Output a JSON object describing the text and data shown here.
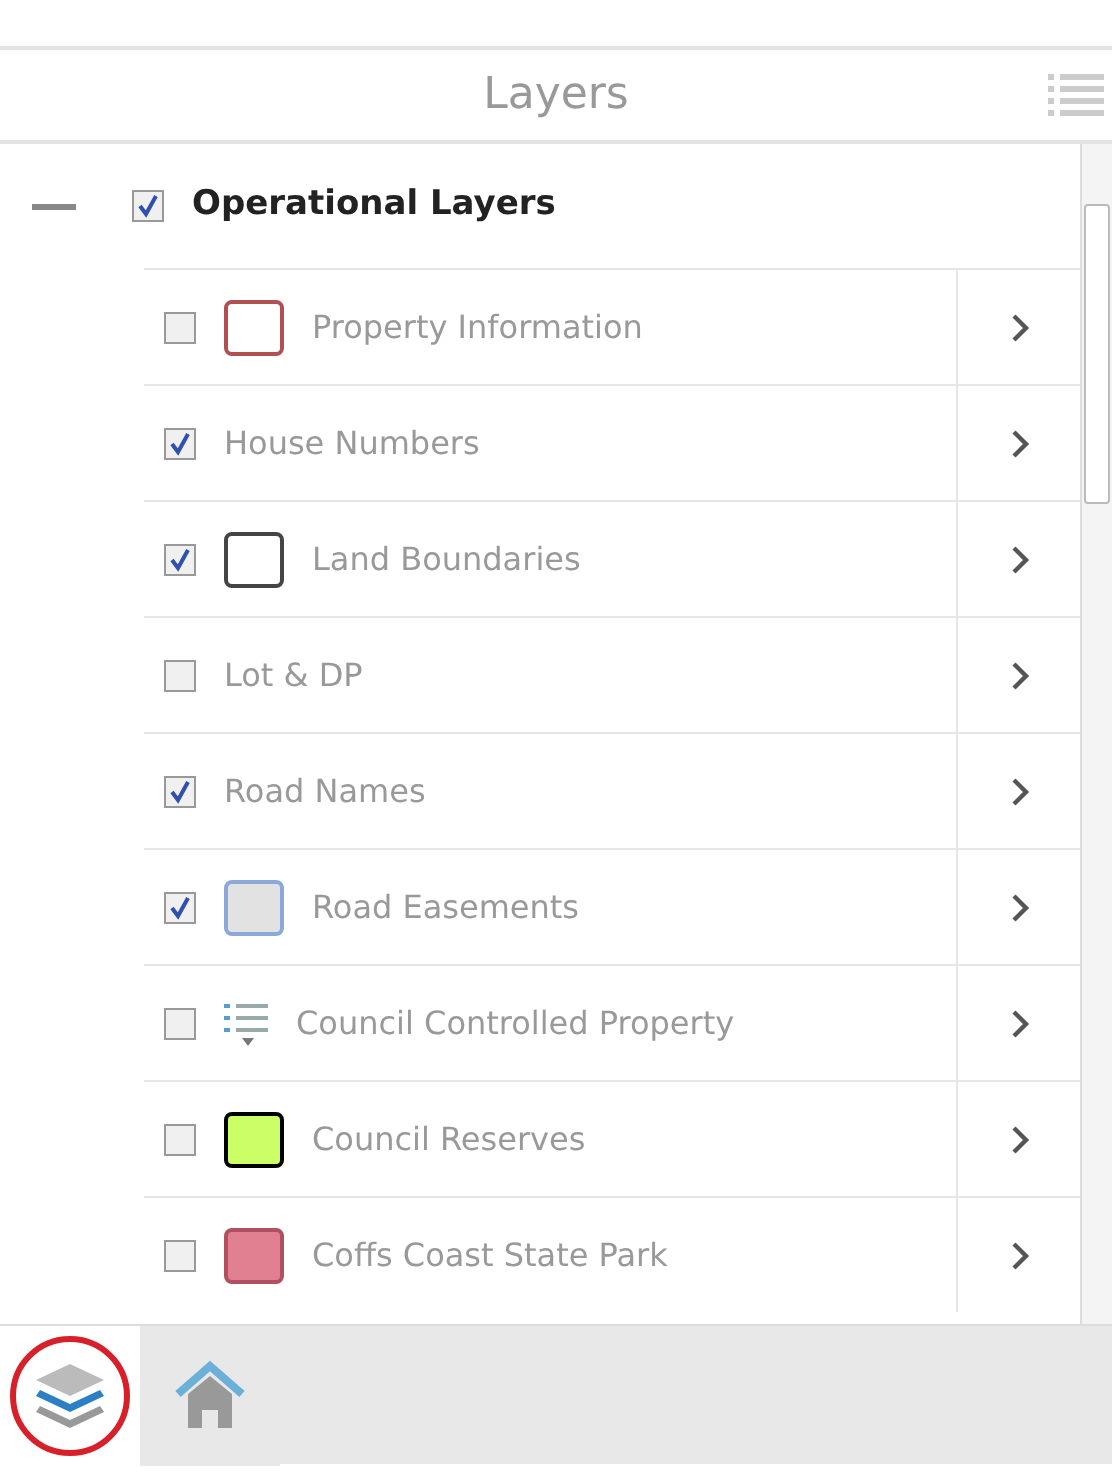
{
  "panel": {
    "title": "Layers"
  },
  "group": {
    "label": "Operational Layers",
    "expanded": true,
    "checked": true
  },
  "layers": [
    {
      "label": "Property Information",
      "checked": false,
      "kind": "swatch",
      "outline": {
        "color": "#b05050"
      },
      "fill": {
        "color": "#ffffff"
      }
    },
    {
      "label": "House Numbers",
      "checked": true,
      "kind": "plain"
    },
    {
      "label": "Land Boundaries",
      "checked": true,
      "kind": "swatch",
      "outline": {
        "color": "#444444"
      },
      "fill": {
        "color": "#ffffff"
      }
    },
    {
      "label": "Lot & DP",
      "checked": false,
      "kind": "plain"
    },
    {
      "label": "Road Names",
      "checked": true,
      "kind": "plain"
    },
    {
      "label": "Road Easements",
      "checked": true,
      "kind": "swatch",
      "outline": {
        "color": "#8aa8d8"
      },
      "fill": {
        "color": "#e2e2e2"
      }
    },
    {
      "label": "Council Controlled Property",
      "checked": false,
      "kind": "legend"
    },
    {
      "label": "Council Reserves",
      "checked": false,
      "kind": "swatch",
      "outline": {
        "color": "#000000"
      },
      "fill": {
        "color": "#ccff66"
      }
    },
    {
      "label": "Coffs Coast State Park",
      "checked": false,
      "kind": "swatch",
      "outline": {
        "color": "#b05060"
      },
      "fill": {
        "color": "#e08090"
      }
    }
  ],
  "toolbar": [
    {
      "kind": "layers",
      "selected": true
    },
    {
      "kind": "home",
      "selected": false
    }
  ]
}
